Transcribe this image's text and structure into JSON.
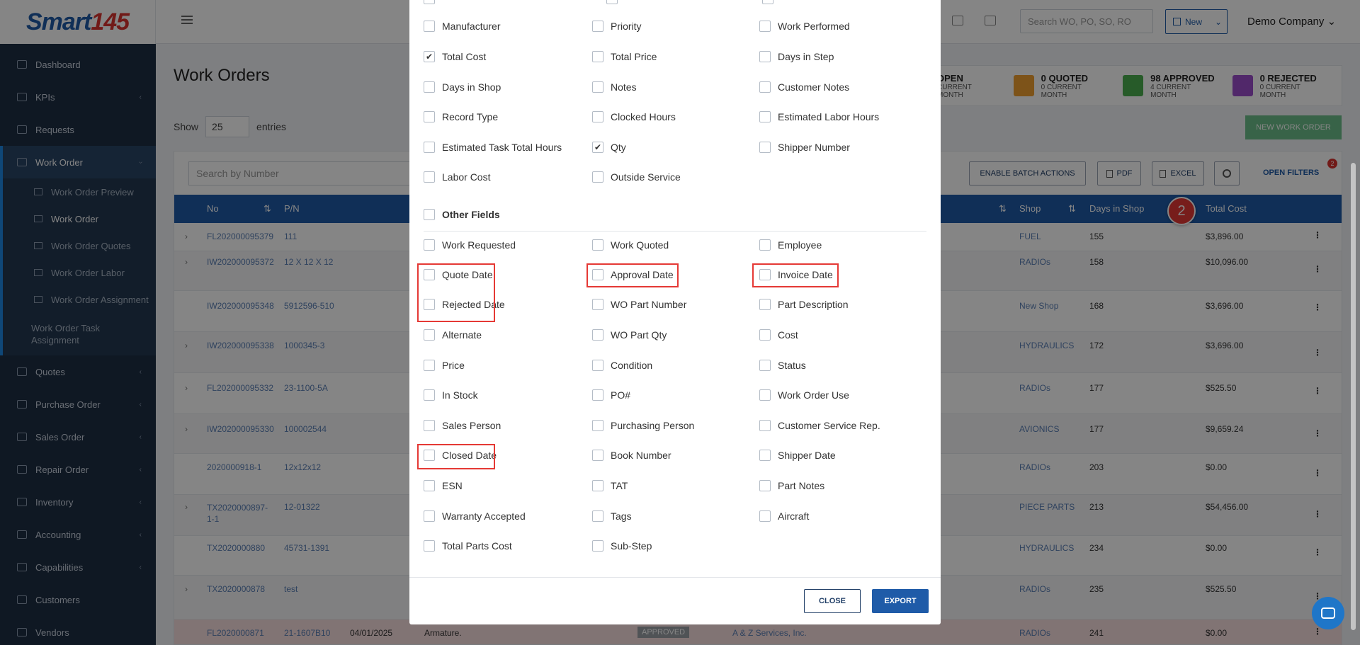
{
  "logo": {
    "text": "Smart",
    "number": "145"
  },
  "sidebar": {
    "items": [
      {
        "label": "Dashboard"
      },
      {
        "label": "KPIs",
        "chev": "‹"
      },
      {
        "label": "Requests"
      },
      {
        "label": "Work Order",
        "chev": "›"
      },
      {
        "label": "Quotes",
        "chev": "‹"
      },
      {
        "label": "Purchase Order",
        "chev": "‹"
      },
      {
        "label": "Sales Order",
        "chev": "‹"
      },
      {
        "label": "Repair Order",
        "chev": "‹"
      },
      {
        "label": "Inventory",
        "chev": "‹"
      },
      {
        "label": "Accounting",
        "chev": "‹"
      },
      {
        "label": "Capabilities",
        "chev": "‹"
      },
      {
        "label": "Customers"
      },
      {
        "label": "Vendors"
      }
    ],
    "sub": [
      {
        "label": "Work Order Preview"
      },
      {
        "label": "Work Order"
      },
      {
        "label": "Work Order Quotes"
      },
      {
        "label": "Work Order Labor"
      },
      {
        "label": "Work Order Assignment"
      },
      {
        "label": "Work Order Task Assignment"
      }
    ]
  },
  "header": {
    "search_placeholder": "Search WO, PO, SO, RO",
    "new_label": "New",
    "new_chevron": "⌄",
    "company": "Demo Company",
    "company_chevron": "⌄"
  },
  "page": {
    "title": "Work Orders"
  },
  "stats": [
    {
      "title": "OPEN",
      "sub": "CURRENT MONTH",
      "color": "#ffffff"
    },
    {
      "title": "0 QUOTED",
      "sub": "0 CURRENT MONTH",
      "color": "#f0a030"
    },
    {
      "title": "98 APPROVED",
      "sub": "4 CURRENT MONTH",
      "color": "#4caf50"
    },
    {
      "title": "0 REJECTED",
      "sub": "0 CURRENT MONTH",
      "color": "#9c4dcc"
    }
  ],
  "show": {
    "label": "Show",
    "value": "25",
    "suffix": "entries"
  },
  "new_wo_label": "NEW WORK ORDER",
  "table": {
    "search_placeholder": "Search by Number",
    "batch_label": "ENABLE BATCH ACTIONS",
    "pdf_label": "PDF",
    "excel_label": "EXCEL",
    "filters_label": "OPEN FILTERS",
    "filters_badge": "2",
    "headers": {
      "no": "No",
      "pn": "P/N",
      "shop": "Shop",
      "days": "Days in Shop",
      "cost": "Total Cost"
    },
    "rows": [
      {
        "no": "FL202000095379",
        "pn": "111",
        "shop": "FUEL",
        "days": "155",
        "cost": "$3,896.00"
      },
      {
        "no": "IW202000095372",
        "pn": "12 X 12 X 12",
        "shop": "RADIOs",
        "days": "158",
        "cost": "$10,096.00"
      },
      {
        "no": "IW202000095348",
        "pn": "5912596-510",
        "shop": "New Shop",
        "days": "168",
        "cost": "$3,696.00"
      },
      {
        "no": "IW202000095338",
        "pn": "1000345-3",
        "shop": "HYDRAULICS",
        "days": "172",
        "cost": "$3,696.00"
      },
      {
        "no": "FL202000095332",
        "pn": "23-1100-5A",
        "shop": "RADIOs",
        "days": "177",
        "cost": "$525.50"
      },
      {
        "no": "IW202000095330",
        "pn": "100002544",
        "shop": "AVIONICS",
        "days": "177",
        "cost": "$9,659.24"
      },
      {
        "no": "2020000918-1",
        "pn": "12x12x12",
        "shop": "RADIOs",
        "days": "203",
        "cost": "$0.00"
      },
      {
        "no": "TX2020000897-1-1",
        "pn": "12-01322",
        "shop": "PIECE PARTS",
        "days": "213",
        "cost": "$54,456.00"
      },
      {
        "no": "TX2020000880",
        "pn": "45731-1391",
        "shop": "HYDRAULICS",
        "days": "234",
        "cost": "$0.00"
      },
      {
        "no": "TX2020000878",
        "pn": "test",
        "shop": "RADIOs",
        "days": "235",
        "cost": "$525.50"
      },
      {
        "no": "FL2020000871",
        "pn": "21-1607B10",
        "date": "04/01/2025",
        "desc": "Armature.",
        "status": "APPROVED",
        "customer": "A & Z Services, Inc.",
        "shop": "RADIOs",
        "days": "241",
        "cost": "$0.00"
      }
    ]
  },
  "step_badge": "2",
  "modal": {
    "col1": [
      {
        "label": "Manufacturer",
        "checked": false
      },
      {
        "label": "Total Cost",
        "checked": true
      },
      {
        "label": "Days in Shop",
        "checked": false
      },
      {
        "label": "Record Type",
        "checked": false
      },
      {
        "label": "Estimated Task Total Hours",
        "checked": false
      },
      {
        "label": "Labor Cost",
        "checked": false
      }
    ],
    "col2": [
      {
        "label": "Priority",
        "checked": false
      },
      {
        "label": "Total Price",
        "checked": false
      },
      {
        "label": "Notes",
        "checked": false
      },
      {
        "label": "Clocked Hours",
        "checked": false
      },
      {
        "label": "Qty",
        "checked": true
      },
      {
        "label": "Outside Service",
        "checked": false
      }
    ],
    "col3": [
      {
        "label": "Work Performed",
        "checked": false
      },
      {
        "label": "Days in Step",
        "checked": false
      },
      {
        "label": "Customer Notes",
        "checked": false
      },
      {
        "label": "Estimated Labor Hours",
        "checked": false
      },
      {
        "label": "Shipper Number",
        "checked": false
      }
    ],
    "other_title": "Other Fields",
    "other_col1": [
      "Work Requested",
      "Quote Date",
      "Rejected Date",
      "Alternate",
      "Price",
      "In Stock",
      "Sales Person",
      "Closed Date",
      "ESN",
      "Warranty Accepted",
      "Total Parts Cost"
    ],
    "other_col2": [
      "Work Quoted",
      "Approval Date",
      "WO Part Number",
      "WO Part Qty",
      "Condition",
      "PO#",
      "Purchasing Person",
      "Book Number",
      "TAT",
      "Tags",
      "Sub-Step"
    ],
    "other_col3": [
      "Employee",
      "Invoice Date",
      "Part Description",
      "Cost",
      "Status",
      "Work Order Use",
      "Customer Service Rep.",
      "Shipper Date",
      "Part Notes",
      "Aircraft"
    ],
    "close_label": "CLOSE",
    "export_label": "EXPORT",
    "check_mark": "✔"
  }
}
